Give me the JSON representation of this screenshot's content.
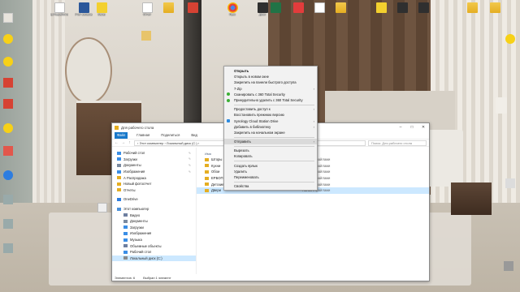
{
  "desktop_icons": [
    {
      "id": "i1",
      "label": "Ц\nРазработка",
      "kind": "doc"
    },
    {
      "id": "i2",
      "label": "Учет\nзаказов.docx",
      "kind": "word"
    },
    {
      "id": "i3",
      "label": "Заказ",
      "kind": "yellow"
    },
    {
      "id": "i4",
      "label": "Отчет",
      "kind": "doc"
    },
    {
      "id": "i5",
      "label": "",
      "kind": "folder"
    },
    {
      "id": "i6",
      "label": "",
      "kind": "red"
    },
    {
      "id": "i7",
      "label": "Пуск",
      "kind": "chrome"
    },
    {
      "id": "i8",
      "label": "Диск",
      "kind": "dark"
    },
    {
      "id": "i9",
      "label": "",
      "kind": "excel"
    },
    {
      "id": "i10",
      "label": "",
      "kind": "pdf"
    },
    {
      "id": "i11",
      "label": "",
      "kind": "doc"
    },
    {
      "id": "i12",
      "label": "",
      "kind": "folder"
    },
    {
      "id": "i13",
      "label": "",
      "kind": "yellow"
    },
    {
      "id": "i14",
      "label": "",
      "kind": "dark"
    },
    {
      "id": "i15",
      "label": "",
      "kind": "dark"
    },
    {
      "id": "i16",
      "label": "",
      "kind": "folder"
    },
    {
      "id": "i17",
      "label": "",
      "kind": "folder"
    }
  ],
  "explorer": {
    "title": "Для рабочего стола",
    "tabs": [
      "Файл",
      "Главная",
      "Поделиться",
      "Вид"
    ],
    "address": "›  Этот компьютер  ›  Локальный диск (C:)  ›",
    "search_placeholder": "Поиск: Для рабочего стола",
    "nav_items": [
      {
        "label": "Рабочий стол",
        "pinned": true,
        "indent": false,
        "color": "#3a8ee6"
      },
      {
        "label": "Загрузки",
        "pinned": true,
        "indent": false,
        "color": "#3a8ee6"
      },
      {
        "label": "Документы",
        "pinned": true,
        "indent": false,
        "color": "#7a8aa0"
      },
      {
        "label": "Изображения",
        "pinned": true,
        "indent": false,
        "color": "#3a8ee6"
      },
      {
        "label": "А Распродажа",
        "pinned": false,
        "indent": false,
        "color": "#e5ae22"
      },
      {
        "label": "Новый фотоотчет",
        "pinned": false,
        "indent": false,
        "color": "#e5ae22"
      },
      {
        "label": "Отчеты",
        "pinned": false,
        "indent": false,
        "color": "#e5ae22"
      }
    ],
    "nav_items_2": [
      {
        "label": "OneDrive",
        "indent": false,
        "color": "#2d7de0"
      }
    ],
    "nav_items_3": [
      {
        "label": "Этот компьютер",
        "indent": false,
        "color": "#4a90d9",
        "selected": false
      },
      {
        "label": "Видео",
        "indent": true,
        "color": "#6e7fa0",
        "selected": false
      },
      {
        "label": "Документы",
        "indent": true,
        "color": "#7a8aa0",
        "selected": false
      },
      {
        "label": "Загрузки",
        "indent": true,
        "color": "#3a8ee6",
        "selected": false
      },
      {
        "label": "Изображения",
        "indent": true,
        "color": "#3a8ee6",
        "selected": false
      },
      {
        "label": "Музыка",
        "indent": true,
        "color": "#3a8ee6",
        "selected": false
      },
      {
        "label": "Объемные объекты",
        "indent": true,
        "color": "#6e7fa0",
        "selected": false
      },
      {
        "label": "Рабочий стол",
        "indent": true,
        "color": "#3a8ee6",
        "selected": false
      },
      {
        "label": "Локальный диск (C:)",
        "indent": true,
        "color": "#8a8a8a",
        "selected": true
      }
    ],
    "column_name": "Имя",
    "column_type": "Тип",
    "files": [
      {
        "name": "Шторы",
        "type": "Папка с файлами",
        "selected": false
      },
      {
        "name": "Кухни",
        "type": "Папка с файлами",
        "selected": false
      },
      {
        "name": "Обои",
        "type": "Папка с файлами",
        "selected": false
      },
      {
        "name": "ЕРБОП",
        "type": "Папка с файлами",
        "selected": false
      },
      {
        "name": "Детские",
        "type": "Папка с файлами",
        "selected": false
      },
      {
        "name": "Двери",
        "type": "Папка с файлами",
        "selected": true
      }
    ],
    "status_count": "Элементов: 6",
    "status_selected": "Выбран 1 элемент"
  },
  "context_menu": {
    "items": [
      {
        "label": "Открыть",
        "bold": true,
        "submenu": false,
        "icon": ""
      },
      {
        "label": "Открыть в новом окне",
        "bold": false,
        "submenu": false,
        "icon": ""
      },
      {
        "label": "Закрепить на панели быстрого доступа",
        "bold": false,
        "submenu": false,
        "icon": ""
      },
      {
        "label": "7-Zip",
        "bold": false,
        "submenu": true,
        "icon": ""
      },
      {
        "label": "Сканировать с 360 Total Security",
        "bold": false,
        "submenu": false,
        "icon": "green"
      },
      {
        "label": "Принудительно удалить с 360 Total Security",
        "bold": false,
        "submenu": false,
        "icon": "green"
      },
      {
        "sep": true
      },
      {
        "label": "Предоставить доступ к",
        "bold": false,
        "submenu": true,
        "icon": ""
      },
      {
        "label": "Восстановить прежнюю версию",
        "bold": false,
        "submenu": false,
        "icon": ""
      },
      {
        "label": "Synology Cloud Station Drive",
        "bold": false,
        "submenu": true,
        "icon": "sync"
      },
      {
        "label": "Добавить в библиотеку",
        "bold": false,
        "submenu": true,
        "icon": ""
      },
      {
        "label": "Закрепить на начальном экране",
        "bold": false,
        "submenu": false,
        "icon": ""
      },
      {
        "sep": true
      },
      {
        "label": "Отправить",
        "bold": false,
        "submenu": true,
        "icon": "",
        "hover": true
      },
      {
        "sep": true
      },
      {
        "label": "Вырезать",
        "bold": false,
        "submenu": false,
        "icon": ""
      },
      {
        "label": "Копировать",
        "bold": false,
        "submenu": false,
        "icon": ""
      },
      {
        "sep": true
      },
      {
        "label": "Создать ярлык",
        "bold": false,
        "submenu": false,
        "icon": ""
      },
      {
        "label": "Удалить",
        "bold": false,
        "submenu": false,
        "icon": ""
      },
      {
        "label": "Переименовать",
        "bold": false,
        "submenu": false,
        "icon": ""
      },
      {
        "sep": true
      },
      {
        "label": "Свойства",
        "bold": false,
        "submenu": false,
        "icon": ""
      }
    ]
  }
}
